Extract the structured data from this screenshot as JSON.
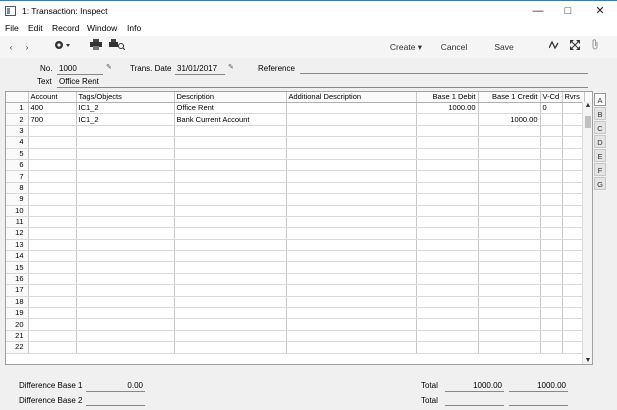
{
  "window": {
    "title": "1: Transaction: Inspect"
  },
  "menu": [
    "File",
    "Edit",
    "Record",
    "Window",
    "Info"
  ],
  "toolbar": {
    "create_label": "Create",
    "cancel_label": "Cancel",
    "save_label": "Save"
  },
  "header": {
    "no_label": "No.",
    "no_value": "1000",
    "date_label": "Trans. Date",
    "date_value": "31/01/2017",
    "reference_label": "Reference",
    "reference_value": "",
    "text_label": "Text",
    "text_value": "Office Rent"
  },
  "grid": {
    "columns": [
      "Account",
      "Tags/Objects",
      "Description",
      "Additional Description",
      "Base 1 Debit",
      "Base 1 Credit",
      "V-Cd",
      "Rvrs"
    ],
    "rows": [
      [
        "400",
        "IC1_2",
        "Office Rent",
        "",
        "1000.00",
        "",
        "0",
        ""
      ],
      [
        "700",
        "IC1_2",
        "Bank Current Account",
        "",
        "",
        "1000.00",
        "",
        ""
      ]
    ],
    "row_count": 22
  },
  "tabs": [
    "A",
    "B",
    "C",
    "D",
    "E",
    "F",
    "G"
  ],
  "footer": {
    "diff1_label": "Difference Base 1",
    "diff1_value": "0.00",
    "diff2_label": "Difference Base 2",
    "diff2_value": "",
    "total_label": "Total",
    "total_debit": "1000.00",
    "total_credit": "1000.00",
    "total2_label": "Total",
    "total2_debit": "",
    "total2_credit": ""
  }
}
